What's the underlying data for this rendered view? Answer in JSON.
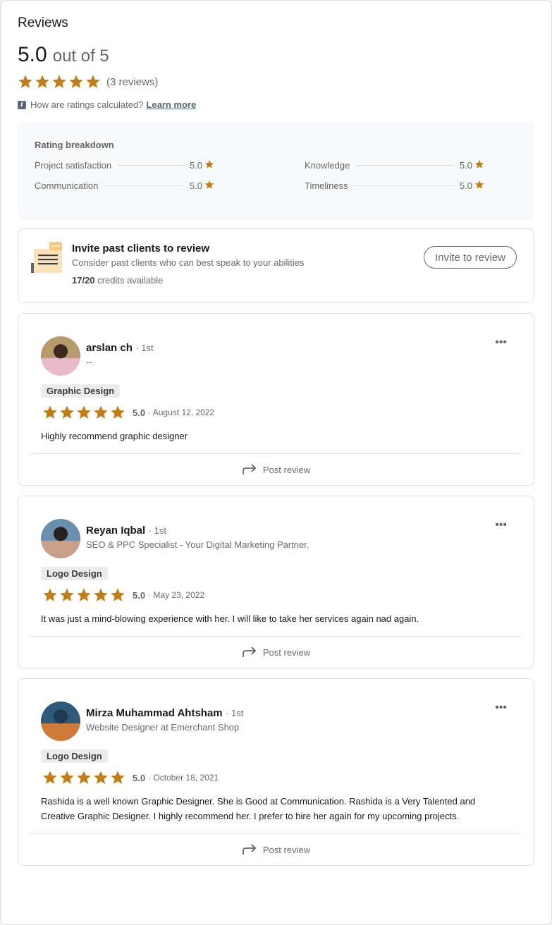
{
  "header": {
    "title": "Reviews",
    "score": "5.0",
    "out_of": "out of 5",
    "overall_rating": 5,
    "reviews_count": "(3 reviews)",
    "info_text": "How are ratings calculated?",
    "learn_more": "Learn more"
  },
  "colors": {
    "star": "#c37d16",
    "breakdown_bg": "#f8f9fa",
    "tag_bg": "#ebebeb"
  },
  "breakdown": {
    "title": "Rating breakdown",
    "items": [
      {
        "label": "Project satisfaction",
        "value": "5.0"
      },
      {
        "label": "Knowledge",
        "value": "5.0"
      },
      {
        "label": "Communication",
        "value": "5.0"
      },
      {
        "label": "Timeliness",
        "value": "5.0"
      }
    ]
  },
  "invite": {
    "title": "Invite past clients to review",
    "subtitle": "Consider past clients who can best speak to your abilities",
    "credits_count": "17/20",
    "credits_label": "credits available",
    "button": "Invite to review"
  },
  "reviews": [
    {
      "name": "arslan ch",
      "degree": "· 1st",
      "headline": "--",
      "tag": "Graphic Design",
      "rating": 5,
      "score": "5.0",
      "date": "· August 12, 2022",
      "body": "Highly recommend graphic designer",
      "post_label": "Post review",
      "more_icon": "overflow-menu-icon"
    },
    {
      "name": "Reyan Iqbal",
      "degree": "· 1st",
      "headline": "SEO & PPC Specialist - Your Digital Marketing Partner.",
      "tag": "Logo Design",
      "rating": 5,
      "score": "5.0",
      "date": "· May 23, 2022",
      "body": "It was just a mind-blowing experience with her. I will like to take her services again nad again.",
      "post_label": "Post review",
      "more_icon": "overflow-menu-icon"
    },
    {
      "name": "Mirza Muhammad Ahtsham",
      "degree": "· 1st",
      "headline": "Website Designer at Emerchant Shop",
      "tag": "Logo Design",
      "rating": 5,
      "score": "5.0",
      "date": "· October 18, 2021",
      "body": "Rashida is a well known Graphic Designer. She is Good at Communication. Rashida is a Very Talented and Creative Graphic Designer. I highly recommend her. I prefer to hire her again for my upcoming projects.",
      "post_label": "Post review",
      "more_icon": "overflow-menu-icon"
    }
  ]
}
